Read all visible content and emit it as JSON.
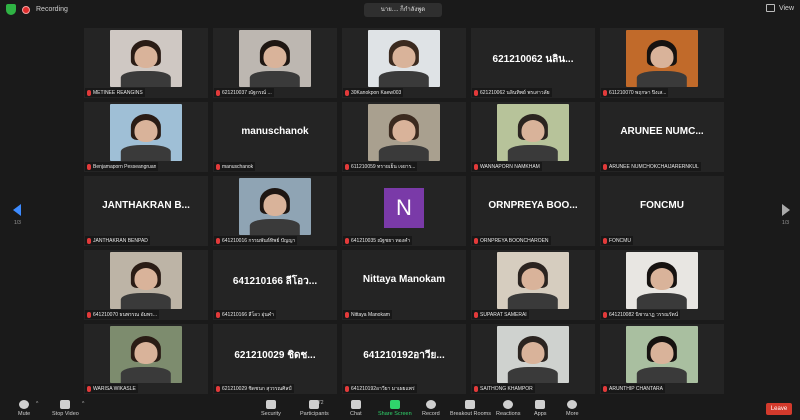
{
  "topbar": {
    "recording_label": "Recording",
    "speaker_text": "นาย.... ก็กำลังพูด",
    "view_label": "View"
  },
  "participants": [
    {
      "kind": "photo",
      "name": "METINEE REANGINS",
      "bg": "#cfc8c3"
    },
    {
      "kind": "photo",
      "name": "621210037 ณัฐกรณ์ ...",
      "bg": "#bdb7b1"
    },
    {
      "kind": "photo",
      "name": "30Kanokpon Kaew003",
      "bg": "#dfe3e6"
    },
    {
      "kind": "text",
      "big": "621210062 นลิน...",
      "name": "621210062 นลินทิพย์ พรเสาวลัย"
    },
    {
      "kind": "photo",
      "name": "611210070 พฤกษา ปิงเส...",
      "bg": "#c16a2a"
    },
    {
      "kind": "photo",
      "name": "Benjamaporn Pesseangruan",
      "bg": "#9fbfd6"
    },
    {
      "kind": "text",
      "big": "manuschanok",
      "name": "manuschanok"
    },
    {
      "kind": "photo",
      "name": "611210059 ทรายเย็น เจยาร...",
      "bg": "#a9a08f"
    },
    {
      "kind": "photo",
      "name": "WANNAPORN NAMKHAM",
      "bg": "#b7c39a"
    },
    {
      "kind": "text",
      "big": "ARUNEE NUMC...",
      "name": "ARUNEE NUMCHOKCHAIJARERNKUL"
    },
    {
      "kind": "text",
      "big": "JANTHAKRAN B...",
      "name": "JANTHAKRAN BENPAD"
    },
    {
      "kind": "photo",
      "name": "641210016 กรรมพันธ์ทิพย์ ปัญญา",
      "bg": "#8fa4b4"
    },
    {
      "kind": "avatar",
      "letter": "N",
      "name": "641210035 ณัฐชยา ทองคำ"
    },
    {
      "kind": "text",
      "big": "ORNPREYA BOO...",
      "name": "ORNPREYA BOONCHAROEN"
    },
    {
      "kind": "text",
      "big": "FONCMU",
      "name": "FONCMU"
    },
    {
      "kind": "photo",
      "name": "641210070 ธนพรรณ อัมพร...",
      "bg": "#bdb4a6"
    },
    {
      "kind": "text",
      "big": "641210166 ลีโอว...",
      "name": "641210166 ลีโอว อุ่นคำ"
    },
    {
      "kind": "text",
      "big": "Nittaya Manokam",
      "name": "Nittaya Manokam"
    },
    {
      "kind": "photo",
      "name": "SUPARAT SAMERAI",
      "bg": "#d6cdbf"
    },
    {
      "kind": "photo",
      "name": "641210082 นิชานาฏ วรรณรัตน์",
      "bg": "#e8e6e2"
    },
    {
      "kind": "photo",
      "name": "WARISA WIKASLE",
      "bg": "#7d8c6e"
    },
    {
      "kind": "text",
      "big": "621210029 ชิดช...",
      "name": "621210029 ชิดชนก สุวรรณศิลป์"
    },
    {
      "kind": "text",
      "big": "641210192อาวีย...",
      "name": "641210192อาวียา มาเผยแพร่"
    },
    {
      "kind": "photo",
      "name": "SAITHONG KHAMPOR",
      "bg": "#cfd2cf"
    },
    {
      "kind": "photo",
      "name": "ARUNTHIP CHANTARA",
      "bg": "#a9bfa0"
    }
  ],
  "pager": {
    "left": "1/3",
    "right": "1/3"
  },
  "toolbar": {
    "mute": "Mute",
    "stop_video": "Stop Video",
    "security": "Security",
    "participants": "Participants",
    "participants_count": "72",
    "chat": "Chat",
    "share_screen": "Share Screen",
    "record": "Record",
    "breakout": "Breakout Rooms",
    "reactions": "Reactions",
    "apps": "Apps",
    "more": "More",
    "leave": "Leave"
  },
  "colors": {
    "accent_green": "#2fd46b",
    "leave_red": "#d33a2c",
    "nav_blue": "#3d8bff"
  }
}
